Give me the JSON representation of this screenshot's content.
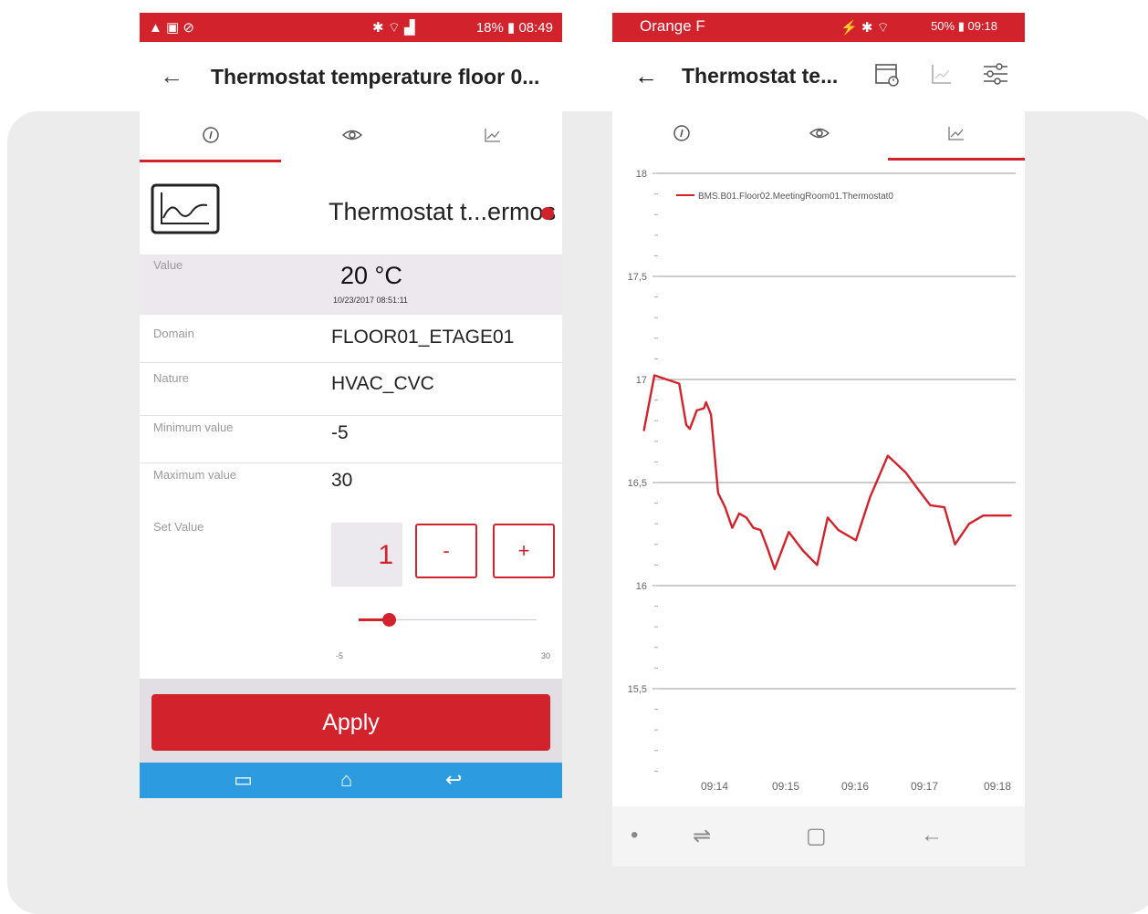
{
  "left_phone": {
    "status": {
      "right_text": "18% ▮ 08:49",
      "left_icons": "▲ ▣ ⊘",
      "mid_icons": "✱ ⌔ ▟"
    },
    "title": "Thermostat temperature floor 0...",
    "back_label": "←",
    "tabs": [
      {
        "icon": "info-icon",
        "glyph": "ⓘ",
        "selected": true
      },
      {
        "icon": "eye-icon",
        "glyph": "👁",
        "selected": false
      },
      {
        "icon": "chart-icon",
        "glyph": "⟋",
        "selected": false
      }
    ],
    "device_name": "Thermostat t...ermos",
    "value_label": "Value",
    "value": "20 °C",
    "value_time": "10/23/2017 08:51:11",
    "domain_label": "Domain",
    "domain": "FLOOR01_ETAGE01",
    "nature_label": "Nature",
    "nature": "HVAC_CVC",
    "min_label": "Minimum value",
    "min": "-5",
    "max_label": "Maximum value",
    "max": "30",
    "set_label": "Set Value",
    "set_value": "1",
    "minus_label": "-",
    "plus_label": "+",
    "slider": {
      "min_label": "-5",
      "max_label": "30",
      "min": -5,
      "max": 30,
      "value": 1
    },
    "apply_label": "Apply",
    "nav": {
      "recents": "▭",
      "home": "⌂",
      "back": "↩"
    },
    "accent": "#d2222b",
    "nav_color": "#2d9be0"
  },
  "right_phone": {
    "status": {
      "carrier": "Orange F",
      "right_text": "50% ▮ 09:18",
      "mid_icons": "⚡ ✱ ⌔"
    },
    "title": "Thermostat te...",
    "back_label": "←",
    "toolbar": {
      "calendar": "calendar-icon",
      "chart": "chart-icon",
      "filter": "sliders-icon"
    },
    "tabs": [
      {
        "icon": "info-icon",
        "glyph": "ⓘ",
        "selected": false
      },
      {
        "icon": "eye-icon",
        "glyph": "👁",
        "selected": false
      },
      {
        "icon": "chart-icon",
        "glyph": "⟋",
        "selected": true
      }
    ],
    "nav": {
      "dot": "•",
      "recents": "⇌",
      "home": "▢",
      "back": "←"
    }
  },
  "chart_data": {
    "type": "line",
    "title": "",
    "xlabel": "",
    "ylabel": "",
    "ylim": [
      15.0,
      18.0
    ],
    "yticks": [
      "18",
      "17,5",
      "17",
      "16,5",
      "16",
      "15,5"
    ],
    "xticks": [
      "09:14",
      "09:15",
      "09:16",
      "09:17",
      "09:18"
    ],
    "grid": true,
    "legend": "top-left",
    "series": [
      {
        "name": "BMS.B01.Floor02.MeetingRoom01.Thermostat0",
        "color": "#d2222b",
        "x": [
          "09:13.0",
          "09:13.15",
          "09:13.5",
          "09:13.6",
          "09:13.65",
          "09:13.75",
          "09:13.85",
          "09:13.88",
          "09:13.95",
          "09:14.05",
          "09:14.15",
          "09:14.25",
          "09:14.35",
          "09:14.45",
          "09:14.55",
          "09:14.65",
          "09:14.75",
          "09:14.85",
          "09:15.05",
          "09:15.25",
          "09:15.45",
          "09:15.6",
          "09:15.75",
          "09:16.0",
          "09:16.2",
          "09:16.45",
          "09:16.7",
          "09:16.85",
          "09:17.05",
          "09:17.25",
          "09:17.4",
          "09:17.6",
          "09:17.8",
          "09:17.9",
          "09:18.0",
          "09:18.05",
          "09:18.1",
          "09:18.2"
        ],
        "values": [
          16.75,
          17.02,
          16.98,
          16.78,
          16.76,
          16.85,
          16.86,
          16.89,
          16.83,
          16.45,
          16.38,
          16.28,
          16.35,
          16.33,
          16.28,
          16.27,
          16.18,
          16.08,
          16.26,
          16.17,
          16.1,
          16.33,
          16.27,
          16.22,
          16.43,
          16.63,
          16.55,
          16.48,
          16.39,
          16.38,
          16.2,
          16.3,
          16.34,
          16.34,
          16.34,
          16.34,
          16.34,
          16.34
        ]
      }
    ]
  }
}
